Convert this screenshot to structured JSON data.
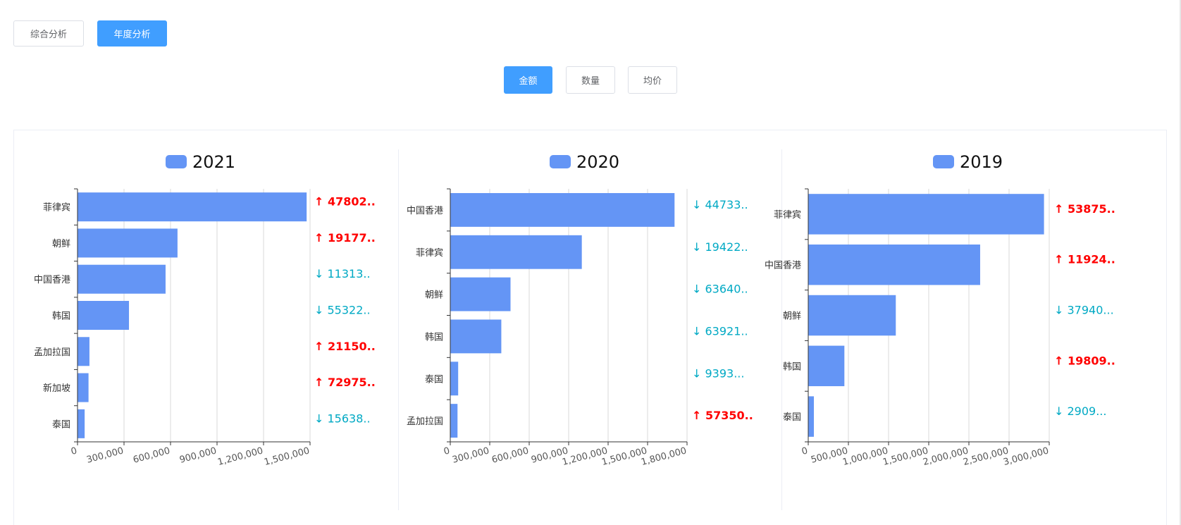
{
  "tabs": {
    "items": [
      {
        "label": "综合分析",
        "active": false
      },
      {
        "label": "年度分析",
        "active": true
      }
    ]
  },
  "metrics": {
    "items": [
      {
        "label": "金额",
        "active": true
      },
      {
        "label": "数量",
        "active": false
      },
      {
        "label": "均价",
        "active": false
      }
    ]
  },
  "colors": {
    "bar": "#6495f5",
    "accent": "#409eff",
    "up": "#ff0000",
    "down": "#00a9c4"
  },
  "chart_data": [
    {
      "type": "bar",
      "orientation": "horizontal",
      "legend": "2021",
      "categories": [
        "菲律宾",
        "朝鲜",
        "中国香港",
        "韩国",
        "孟加拉国",
        "新加坡",
        "泰国"
      ],
      "values": [
        1478000,
        645000,
        568000,
        332000,
        77000,
        71000,
        46000
      ],
      "xlim": [
        0,
        1500000
      ],
      "xticks": [
        "0",
        "300,000",
        "600,000",
        "900,000",
        "1,200,000",
        "1,500,000"
      ],
      "grid": true,
      "annotations": [
        {
          "dir": "up",
          "text": "↑ 47802.."
        },
        {
          "dir": "up",
          "text": "↑ 19177.."
        },
        {
          "dir": "down",
          "text": "↓ 11313.."
        },
        {
          "dir": "down",
          "text": "↓ 55322.."
        },
        {
          "dir": "up",
          "text": "↑ 21150.."
        },
        {
          "dir": "up",
          "text": "↑ 72975.."
        },
        {
          "dir": "down",
          "text": "↓ 15638.."
        }
      ]
    },
    {
      "type": "bar",
      "orientation": "horizontal",
      "legend": "2020",
      "categories": [
        "中国香港",
        "菲律宾",
        "朝鲜",
        "韩国",
        "泰国",
        "孟加拉国"
      ],
      "values": [
        1705000,
        1000000,
        458000,
        388000,
        60000,
        55000
      ],
      "xlim": [
        0,
        1800000
      ],
      "xticks": [
        "0",
        "300,000",
        "600,000",
        "900,000",
        "1,200,000",
        "1,500,000",
        "1,800,000"
      ],
      "grid": true,
      "annotations": [
        {
          "dir": "down",
          "text": "↓ 44733.."
        },
        {
          "dir": "down",
          "text": "↓ 19422.."
        },
        {
          "dir": "down",
          "text": "↓ 63640.."
        },
        {
          "dir": "down",
          "text": "↓ 63921.."
        },
        {
          "dir": "down",
          "text": "↓ 9393..."
        },
        {
          "dir": "up",
          "text": "↑ 57350.."
        }
      ]
    },
    {
      "type": "bar",
      "orientation": "horizontal",
      "legend": "2019",
      "categories": [
        "菲律宾",
        "中国香港",
        "朝鲜",
        "韩国",
        "泰国"
      ],
      "values": [
        2935000,
        2140000,
        1090000,
        450000,
        70000
      ],
      "xlim": [
        0,
        3000000
      ],
      "xticks": [
        "0",
        "500,000",
        "1,000,000",
        "1,500,000",
        "2,000,000",
        "2,500,000",
        "3,000,000"
      ],
      "grid": true,
      "annotations": [
        {
          "dir": "up",
          "text": "↑ 53875.."
        },
        {
          "dir": "up",
          "text": "↑ 11924.."
        },
        {
          "dir": "down",
          "text": "↓ 37940..."
        },
        {
          "dir": "up",
          "text": "↑ 19809.."
        },
        {
          "dir": "down",
          "text": "↓ 2909..."
        }
      ]
    }
  ]
}
